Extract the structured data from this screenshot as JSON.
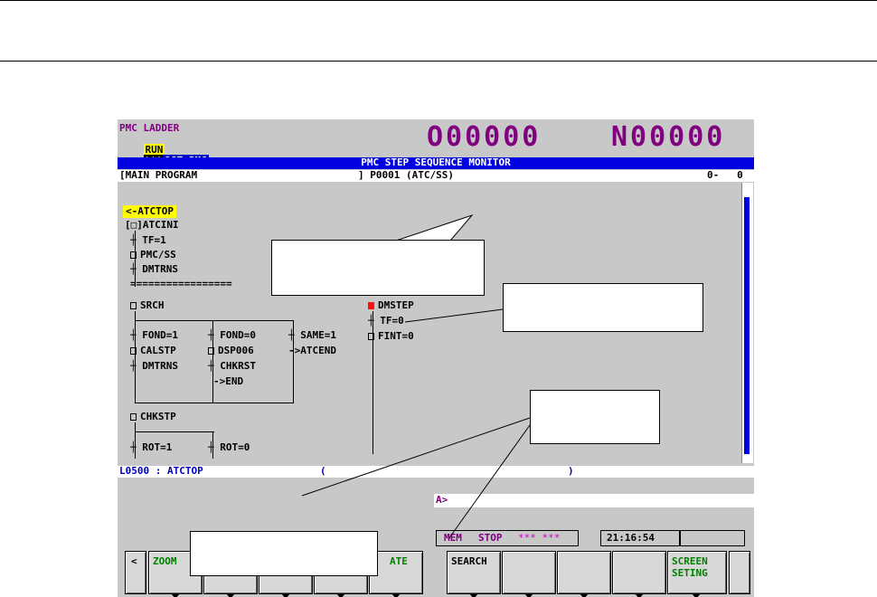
{
  "header": {
    "screen_name": "PMC LADDER",
    "run_label": "RUN",
    "stars_label": "***",
    "pmc_label": "1ST PMC",
    "o_number": "O00000",
    "n_number": "N00000"
  },
  "title": "PMC STEP SEQUENCE MONITOR",
  "program_line": {
    "left": "[MAIN PROGRAM",
    "mid": "] P0001 (ATC/SS)",
    "right": "0-   0"
  },
  "jump_label": "<-ATCTOP",
  "steps": {
    "atcini": "[□]ATCINI",
    "tf1": "TF=1",
    "pmc_ss": "PMC/SS",
    "dmtrns1": "DMTRNS",
    "divider": "=================",
    "srch": "SRCH",
    "fond1": "FOND=1",
    "fond0": "FOND=0",
    "same1": "SAME=1",
    "calstp": "CALSTP",
    "dsp006": "DSP006",
    "atcend": "->ATCEND",
    "dmtrns2": "DMTRNS",
    "chkrst": "CHKRST",
    "end": "->END",
    "chkstp": "CHKSTP",
    "rot1": "ROT=1",
    "rot0": "ROT=0",
    "dmstep": "DMSTEP",
    "tf0": "TF=0",
    "fint0": "FINT=0"
  },
  "status_line": {
    "left": "L0500 : ATCTOP",
    "paren_open": "(",
    "paren_close": ")"
  },
  "command_prompt": "A>",
  "mode_bar": {
    "mode": "MEM",
    "state": "STOP",
    "flags": "*** ***",
    "time": "21:16:54"
  },
  "softkeys": {
    "left_arrow": "<",
    "k1": "ZOOM",
    "k2": "",
    "k3": "",
    "k4": "",
    "k5": "ATE",
    "k6": "SEARCH",
    "k7": "",
    "k8": "",
    "k9": "",
    "k10": "SCREEN\nSETING"
  },
  "colors": {
    "accent": "#0000e0",
    "purple": "#800080",
    "green": "#008000",
    "active_step": "#ff1010",
    "highlight": "#ffff00"
  }
}
